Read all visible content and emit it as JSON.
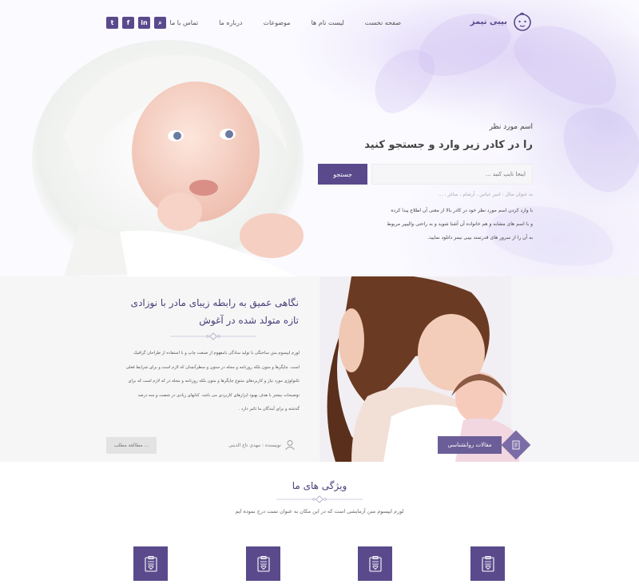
{
  "header": {
    "logo_text": "بیبی نیمز",
    "nav": [
      "صفحه نخست",
      "لیست نام ها",
      "موضوعات",
      "درباره ما",
      "تماس با ما"
    ],
    "social": [
      {
        "icon": "search-icon",
        "glyph": "⌕"
      },
      {
        "icon": "linkedin-icon",
        "glyph": "in"
      },
      {
        "icon": "facebook-icon",
        "glyph": "f"
      },
      {
        "icon": "twitter-icon",
        "glyph": "t"
      }
    ]
  },
  "hero": {
    "small_title": "اسم مورد نظر",
    "title": "را در کادر زیر وارد و جستجو کنید",
    "search_placeholder": "اینجا تایپ کنید ...",
    "search_button": "جستجو",
    "hint": "به عنوان مثال : امیر عباس ، آرشام ، ساغر ، ...",
    "desc_lines": [
      "با وارد کردن اسم مورد نظر خود در کادر بالا از معنی آن اطلاع پیدا کرده",
      "و با اسم های مشابه و هم خانواده آن آشنا شوید و به راحتی والپیپر مربوط",
      "به آن را از سرور های قدرتمند بیبی نیمز دانلود نمایید."
    ]
  },
  "article": {
    "title_line1": "نگاهی عمیق به رابطه زیبای مادر با نوزادی",
    "title_line2": "تازه متولد شده در آغوش",
    "body_lines": [
      "لورم ایپسوم متن ساختگی با تولید سادگی نامفهوم از صنعت چاپ و با استفاده از طراحان گرافیک",
      "است. چاپگرها و متون بلکه روزنامه و مجله در ستون و سطرآنچنان که لازم است و برای شرایط فعلی",
      "تکنولوژی مورد نیاز و کاربردهای متنوع چاپگرها و متون بلکه روزنامه و مجله در که لازم است که برای",
      "توضیحات بیشتر با هدف بهبود ابزارهای کاربردی می باشد. کتابهای زیادی در شصت و سه درصد",
      "گذشته و برای آیندگان ما تاثیر دارد ."
    ],
    "author": "نویسنده : مهدی تاج الدینی",
    "more_button": "مطالعه مطلب ...",
    "category": "مقالات روانشناسی"
  },
  "features": {
    "title": "ویژگی های ما",
    "subtitle": "لورم ایپسوم متن آزمایشی است که در این مکان به عنوان تست درج نموده ایم"
  },
  "colors": {
    "primary": "#5a4a8c",
    "accent_light": "#7a6ca6",
    "section_bg": "#f6f6f6"
  }
}
